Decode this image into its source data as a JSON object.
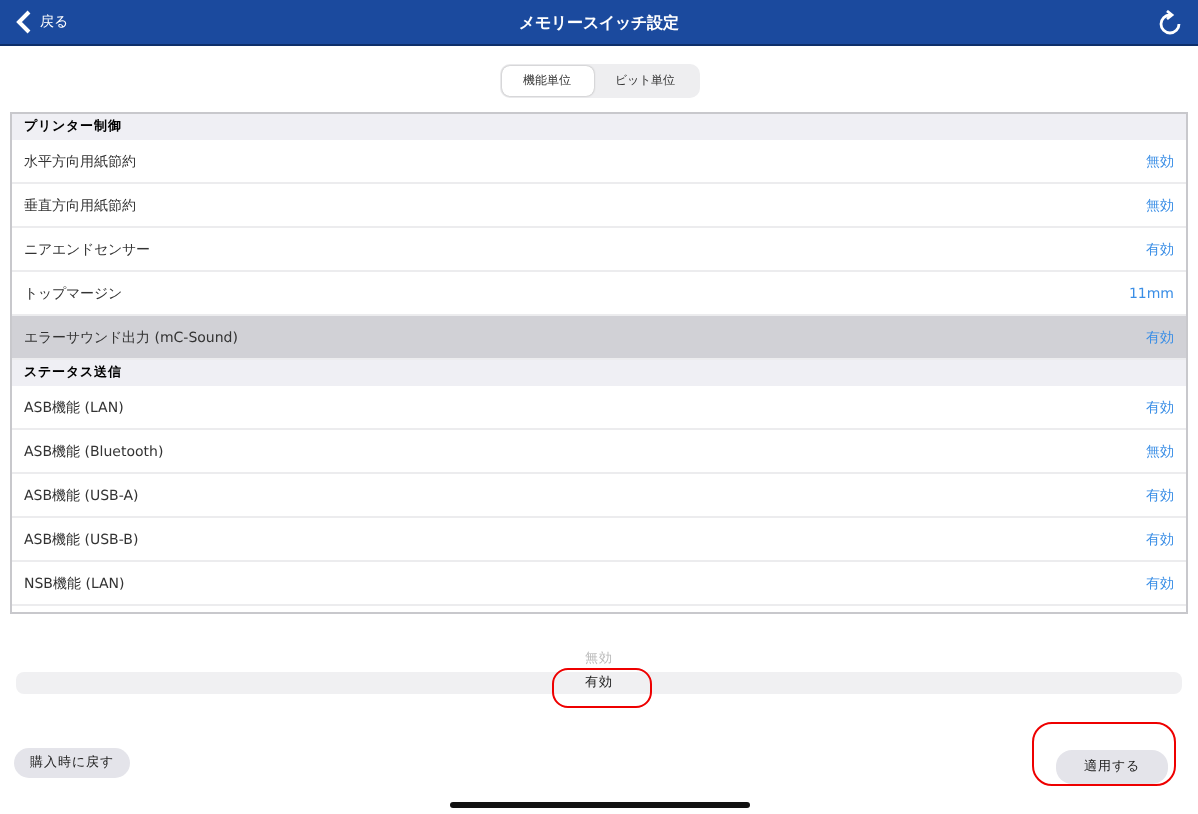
{
  "nav": {
    "back": "戻る",
    "title": "メモリースイッチ設定"
  },
  "segments": [
    {
      "label": "機能単位",
      "selected": true
    },
    {
      "label": "ビット単位",
      "selected": false
    }
  ],
  "sections": [
    {
      "title": "プリンター制御",
      "rows": [
        {
          "label": "水平方向用紙節約",
          "value": "無効",
          "selected": false
        },
        {
          "label": "垂直方向用紙節約",
          "value": "無効",
          "selected": false
        },
        {
          "label": "ニアエンドセンサー",
          "value": "有効",
          "selected": false
        },
        {
          "label": "トップマージン",
          "value": "11mm",
          "selected": false
        },
        {
          "label": "エラーサウンド出力 (mC-Sound)",
          "value": "有効",
          "selected": true
        }
      ]
    },
    {
      "title": "ステータス送信",
      "rows": [
        {
          "label": "ASB機能 (LAN)",
          "value": "有効",
          "selected": false
        },
        {
          "label": "ASB機能 (Bluetooth)",
          "value": "無効",
          "selected": false
        },
        {
          "label": "ASB機能 (USB-A)",
          "value": "有効",
          "selected": false
        },
        {
          "label": "ASB機能 (USB-B)",
          "value": "有効",
          "selected": false
        },
        {
          "label": "NSB機能 (LAN)",
          "value": "有効",
          "selected": false
        }
      ]
    }
  ],
  "picker": [
    {
      "label": "無効",
      "selected": false
    },
    {
      "label": "有効",
      "selected": true
    }
  ],
  "buttons": {
    "reset": "購入時に戻す",
    "apply": "適用する"
  }
}
